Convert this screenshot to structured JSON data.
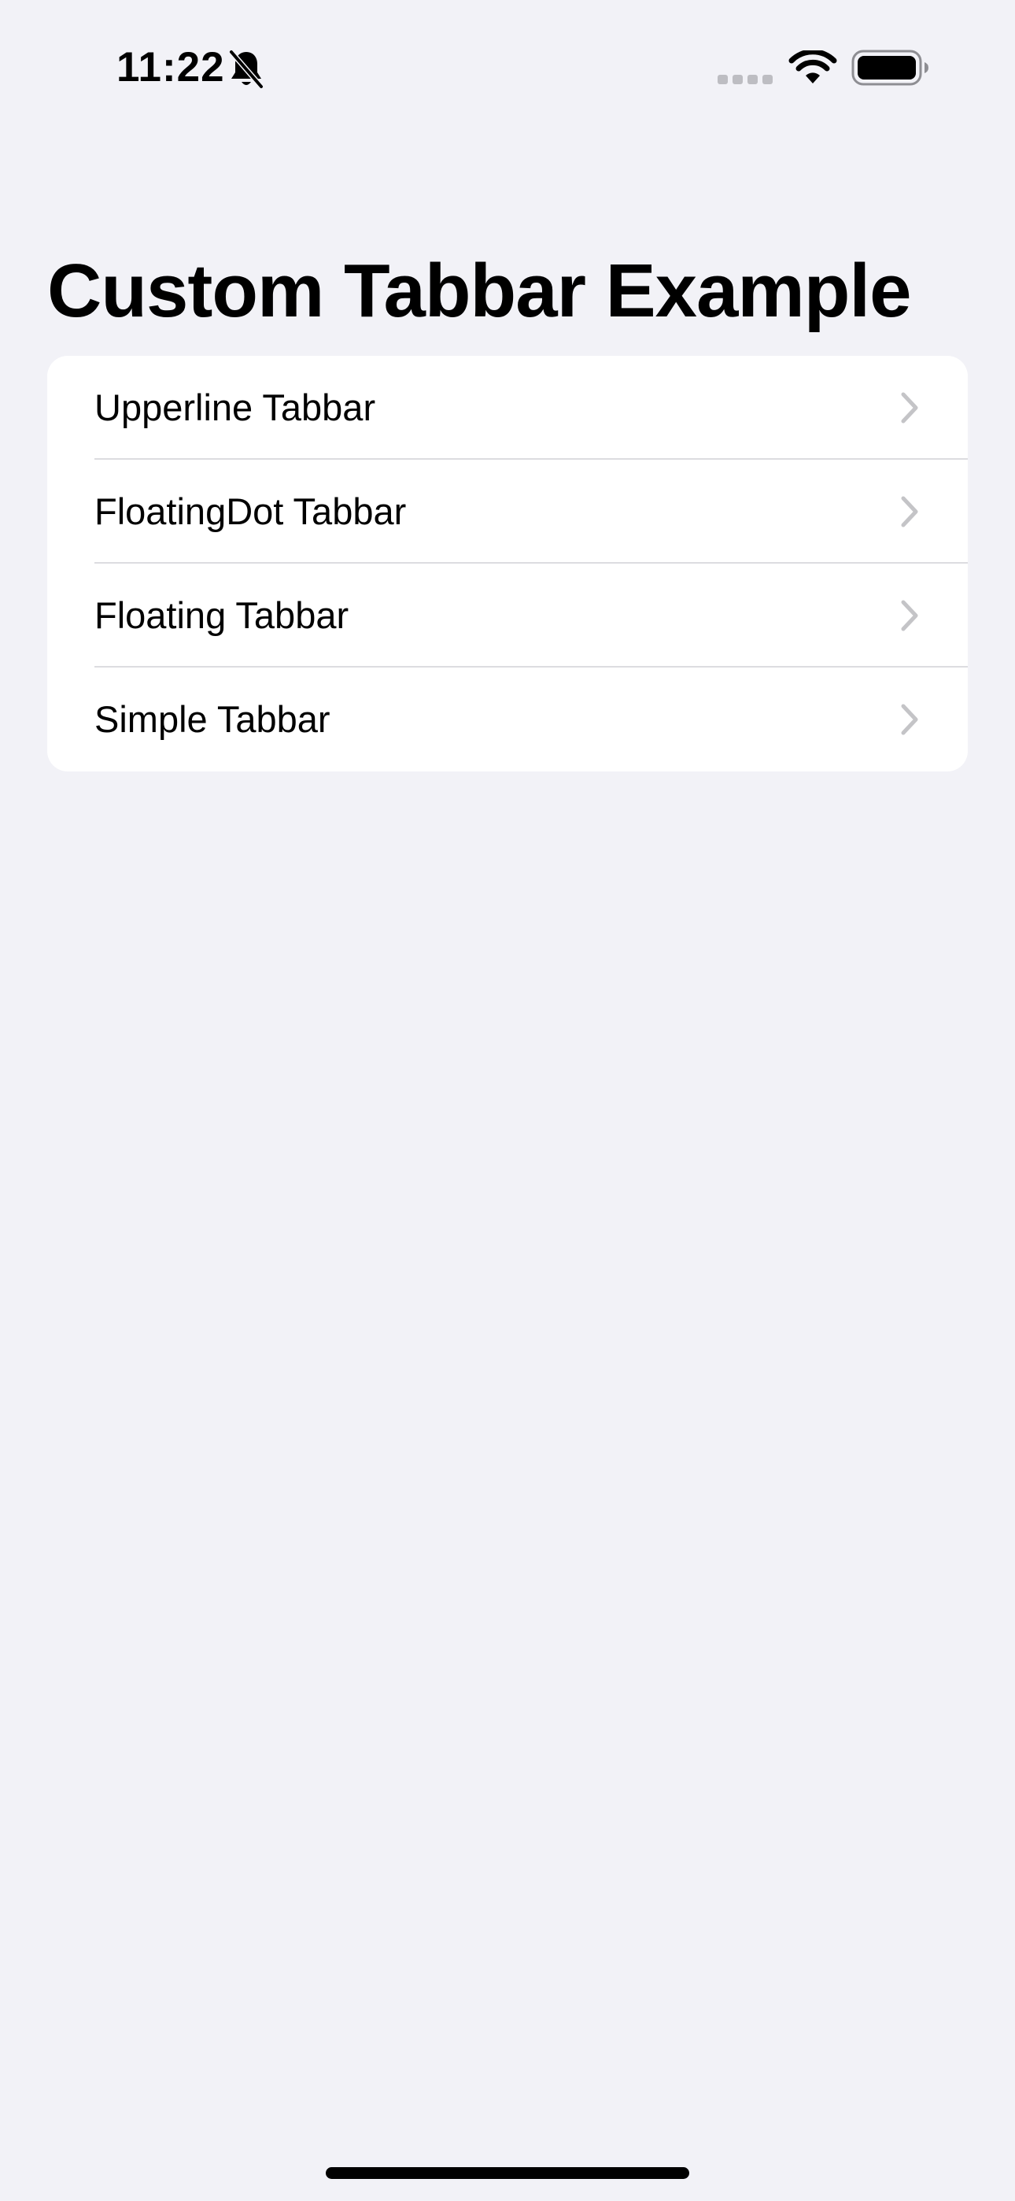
{
  "status_bar": {
    "time": "11:22",
    "icons": [
      "bell-slash-icon",
      "cellular-signal-icon",
      "wifi-icon",
      "battery-icon"
    ]
  },
  "title": "Custom Tabbar Example",
  "list": {
    "items": [
      {
        "label": "Upperline Tabbar",
        "icon": "chevron-right-icon"
      },
      {
        "label": "FloatingDot Tabbar",
        "icon": "chevron-right-icon"
      },
      {
        "label": "Floating Tabbar",
        "icon": "chevron-right-icon"
      },
      {
        "label": "Simple Tabbar",
        "icon": "chevron-right-icon"
      }
    ]
  },
  "colors": {
    "background": "#f2f2f7",
    "card": "#ffffff",
    "text": "#000000",
    "chevron": "#c4c4c7",
    "divider": "#dcdce0"
  }
}
